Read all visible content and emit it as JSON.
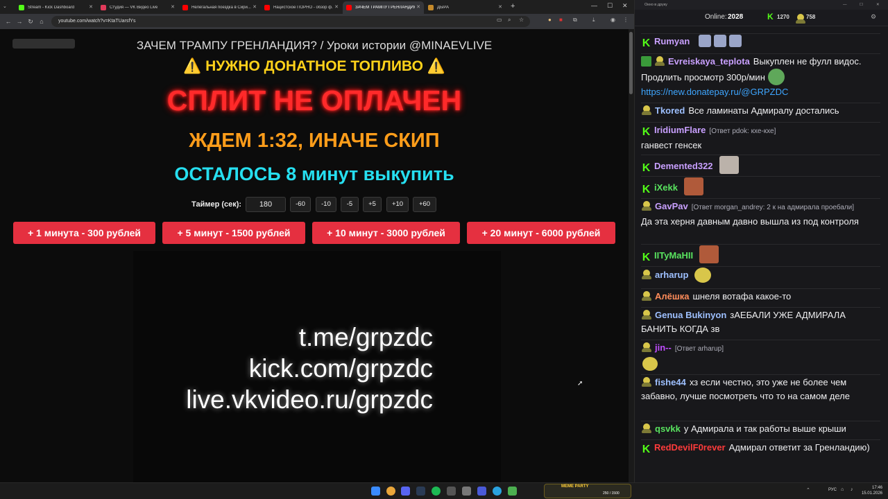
{
  "browser": {
    "tabs": [
      {
        "title": "Stream - Kick Dashboard",
        "fav_color": "#53fc18",
        "active": false
      },
      {
        "title": "Студия — VK Видео Live",
        "fav_color": "#e03a5a",
        "active": false
      },
      {
        "title": "Нелегальная поездка в Сири...",
        "fav_color": "#ff0000",
        "active": false
      },
      {
        "title": "Нацистское ПОРНО - обзор ф...",
        "fav_color": "#ff0000",
        "active": false
      },
      {
        "title": "ЗАЧЕМ ТРАМПУ ГРЕНЛАНДИЯ?...",
        "fav_color": "#ff0000",
        "active": true
      },
      {
        "title": "ДЫРА",
        "fav_color": "#c58a2a",
        "active": false
      }
    ],
    "url": "youtube.com/watch?v=KtaTUarsfYs",
    "new_tab": "+"
  },
  "video": {
    "title": "ЗАЧЕМ ТРАМПУ ГРЕНЛАНДИЯ? / Уроки истории @MINAEVLIVE"
  },
  "overlay": {
    "fuel": "⚠️ НУЖНО ДОНАТНОЕ ТОПЛИВО ⚠️",
    "split": "СПЛИТ НЕ ОПЛАЧЕН",
    "wait": "ЖДЕМ 1:32, ИНАЧЕ СКИП",
    "remaining": "ОСТАЛОСЬ 8 минут выкупить",
    "timer_label": "Таймер (сек):",
    "timer_value": "180",
    "timer_buttons": [
      "-60",
      "-10",
      "-5",
      "+5",
      "+10",
      "+60"
    ],
    "donate_buttons": [
      "+ 1 минута - 300 рублей",
      "+ 5 минут - 1500 рублей",
      "+ 10 минут - 3000 рублей",
      "+ 20 минут - 6000 рублей"
    ],
    "links": [
      "t.me/grpzdc",
      "kick.com/grpzdc",
      "live.vkvideo.ru/grpzdc"
    ]
  },
  "chat_window": {
    "title": "Окно в друку",
    "online_label": "Online:",
    "online_count": "2028",
    "kick_count": "1270",
    "vk_count": "758"
  },
  "chat": [
    {
      "user": "Rumyan",
      "color": "#c9a0ff",
      "badge": "kick",
      "text": "",
      "reply": "",
      "emote": "#9aa5c8"
    },
    {
      "user": "Evreiskaya_teplota",
      "color": "#c9a0ff",
      "badge": "pepe",
      "text": "Выкуплен не фулл видос. Продлить просмотр 300р/мин",
      "reply": "",
      "link": "https://new.donatepay.ru/@GRPZDC"
    },
    {
      "user": "Tkored",
      "color": "#9ec0ff",
      "badge": "pepe",
      "text": "Все ламинаты Адмиралу достались",
      "reply": ""
    },
    {
      "user": "IridiumFlare",
      "color": "#c9a0ff",
      "badge": "kick",
      "text": "ганвест генсек",
      "reply": "[Ответ pdok: кхе-кхе]"
    },
    {
      "user": "Demented322",
      "color": "#c9a0ff",
      "badge": "kick",
      "text": "",
      "reply": "",
      "emote": "#bbb2aa"
    },
    {
      "user": "iXekk",
      "color": "#59e35f",
      "badge": "kick",
      "text": "",
      "reply": "",
      "emote": "#b05a3a"
    },
    {
      "user": "GavPav",
      "color": "#c9a0ff",
      "badge": "pepe",
      "text": "Да эта херня давным давно вышла из под контроля",
      "reply": "[Ответ morgan_andrey: 2 к на адмирала проебали]"
    },
    {
      "user": "IITyMaHII",
      "color": "#59e35f",
      "badge": "kick",
      "text": "",
      "reply": "",
      "emote": "#b05a3a"
    },
    {
      "user": "arharup",
      "color": "#9ec0ff",
      "badge": "pepe",
      "text": "",
      "reply": "",
      "emote": "#d8c64a"
    },
    {
      "user": "Алёшка",
      "color": "#ff8c5a",
      "badge": "pepe",
      "text": "шнеля вотафа какое-то",
      "reply": ""
    },
    {
      "user": "Genua Bukinyon",
      "color": "#9ec0ff",
      "badge": "pepe",
      "text": "зАЕБАЛИ УЖЕ АДМИРАЛА БАНИТЬ КОГДА зв",
      "reply": ""
    },
    {
      "user": "jin--",
      "color": "#c04dff",
      "badge": "pepe",
      "text": "",
      "reply": "[Ответ arharup]"
    },
    {
      "user": "fishe44",
      "color": "#9ec0ff",
      "badge": "pepe",
      "text": "хз если честно, это уже не более чем забавно, лучше посмотреть что то на самом деле",
      "reply": ""
    },
    {
      "user": "qsvkk",
      "color": "#59e35f",
      "badge": "pepe",
      "text": "у Адмирала и так работы выше крыши",
      "reply": ""
    },
    {
      "user": "RedDevilF0rever",
      "color": "#ff3b3b",
      "badge": "kick",
      "text": "Адмирал ответит за Гренландию)",
      "reply": ""
    }
  ],
  "taskbar": {
    "meme_label": "MEME PARTY",
    "meme_progress": "250 / 1500",
    "lang": "РУС",
    "time": "17:46",
    "date": "15.01.2026"
  }
}
